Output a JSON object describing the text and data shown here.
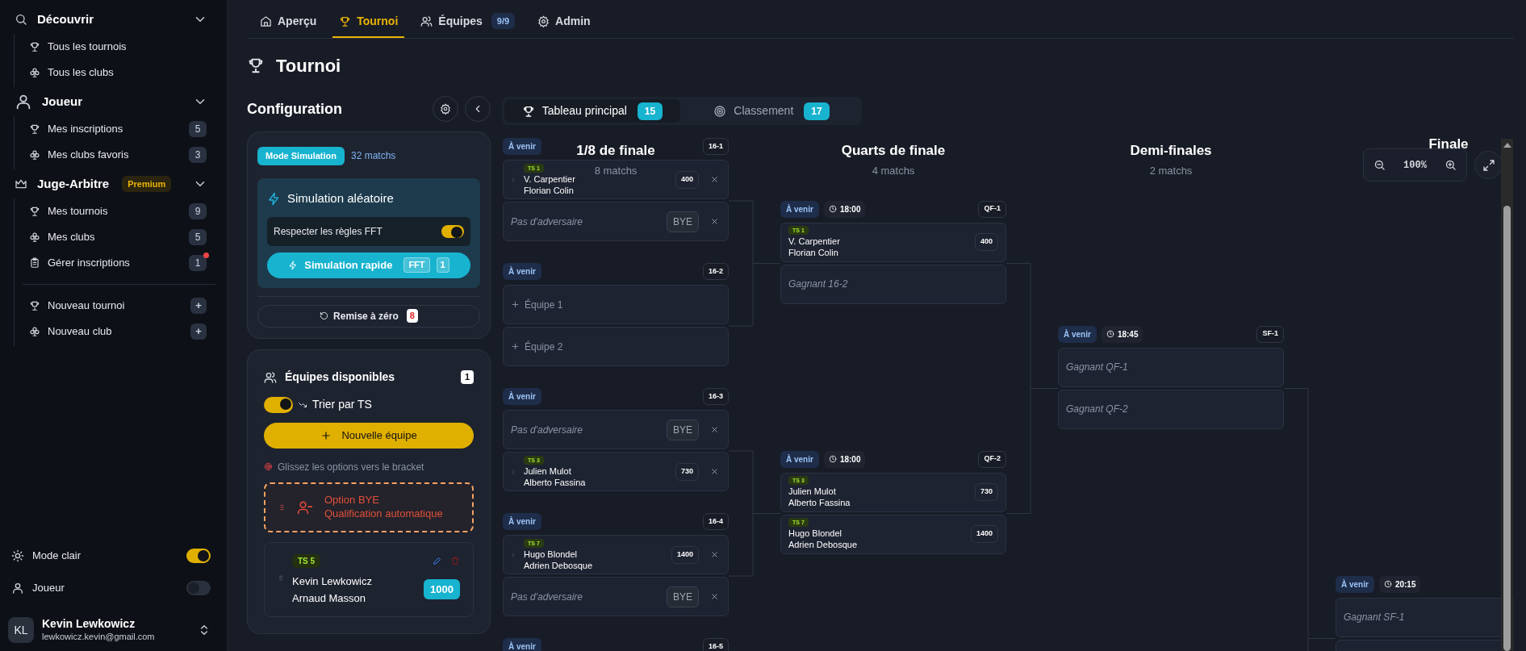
{
  "sidebar": {
    "sections": [
      {
        "title": "Découvrir",
        "expanded": true,
        "items": [
          {
            "label": "Tous les tournois",
            "notification": false
          },
          {
            "label": "Tous les clubs",
            "notification": false
          }
        ]
      },
      {
        "title": "Joueur",
        "expanded": true,
        "items": [
          {
            "label": "Mes inscriptions",
            "count": "5",
            "notification": false
          },
          {
            "label": "Mes clubs favoris",
            "count": "3",
            "notification": false
          }
        ]
      },
      {
        "title": "Juge-Arbitre",
        "badge": "Premium",
        "expanded": true,
        "items": [
          {
            "label": "Mes tournois",
            "count": "9",
            "notification": false
          },
          {
            "label": "Mes clubs",
            "count": "5",
            "notification": false
          },
          {
            "label": "Gérer inscriptions",
            "count": "1",
            "notification": true
          }
        ],
        "actions": [
          {
            "label": "Nouveau tournoi",
            "button": "+"
          },
          {
            "label": "Nouveau club",
            "button": "+"
          }
        ]
      }
    ],
    "settings": [
      {
        "label": "Mode clair",
        "on": true
      },
      {
        "label": "Joueur",
        "on": false
      }
    ],
    "user": {
      "initials": "KL",
      "name": "Kevin Lewkowicz",
      "email": "lewkowicz.kevin@gmail.com"
    }
  },
  "nav_tabs": [
    {
      "label": "Aperçu",
      "selected": false
    },
    {
      "label": "Tournoi",
      "selected": true
    },
    {
      "label": "Équipes",
      "badge": "9/9",
      "selected": false
    },
    {
      "label": "Admin",
      "selected": false
    }
  ],
  "page_title": "Tournoi",
  "config": {
    "title": "Configuration",
    "mode": "Mode Simulation",
    "match_count": "32 matchs",
    "simulation": {
      "title": "Simulation aléatoire",
      "rule_label": "Respecter les règles FFT",
      "rule_on": true,
      "button": "Simulation rapide",
      "button_tag": "FFT",
      "button_count": "1"
    },
    "reset": {
      "label": "Remise à zéro",
      "count": "8"
    }
  },
  "teams_panel": {
    "title": "Équipes disponibles",
    "count": "1",
    "sort_on": true,
    "sort_label": "Trier par TS",
    "new_button": "Nouvelle équipe",
    "hint": "Glissez les options vers le bracket",
    "bye_option": {
      "title": "Option BYE",
      "subtitle": "Qualification automatique"
    },
    "teams": [
      {
        "seed": "TS 5",
        "players": [
          "Kevin Lewkowicz",
          "Arnaud Masson"
        ],
        "points": "1000"
      }
    ]
  },
  "bracket": {
    "tabs": [
      {
        "label": "Tableau principal",
        "count": "15",
        "selected": true
      },
      {
        "label": "Classement",
        "count": "17",
        "selected": false
      }
    ],
    "zoom": "100%",
    "rounds": [
      {
        "title": "1/8 de finale",
        "subtitle": "8 matchs",
        "matches": [
          {
            "status": "À venir",
            "code": "16-1",
            "slots": [
              {
                "kind": "team",
                "seed": "TS 1",
                "players": [
                  "V. Carpentier",
                  "Florian Colin"
                ],
                "points": "400",
                "draggable": true,
                "removable": true
              },
              {
                "kind": "bye",
                "label": "Pas d'adversaire",
                "tag": "BYE",
                "removable": true
              }
            ]
          },
          {
            "status": "À venir",
            "code": "16-2",
            "slots": [
              {
                "kind": "add",
                "label": "Équipe 1"
              },
              {
                "kind": "add",
                "label": "Équipe 2"
              }
            ]
          },
          {
            "status": "À venir",
            "code": "16-3",
            "slots": [
              {
                "kind": "bye",
                "label": "Pas d'adversaire",
                "tag": "BYE",
                "removable": true
              },
              {
                "kind": "team",
                "seed": "TS 3",
                "players": [
                  "Julien Mulot",
                  "Alberto Fassina"
                ],
                "points": "730",
                "draggable": true,
                "removable": true
              }
            ]
          },
          {
            "status": "À venir",
            "code": "16-4",
            "slots": [
              {
                "kind": "team",
                "seed": "TS 7",
                "players": [
                  "Hugo Blondel",
                  "Adrien Debosque"
                ],
                "points": "1400",
                "draggable": true,
                "removable": true
              },
              {
                "kind": "bye",
                "label": "Pas d'adversaire",
                "tag": "BYE",
                "removable": true
              }
            ]
          },
          {
            "status": "À venir",
            "code": "16-5"
          }
        ]
      },
      {
        "title": "Quarts de finale",
        "subtitle": "4 matchs",
        "matches": [
          {
            "status": "À venir",
            "time": "18:00",
            "code": "QF-1",
            "slots": [
              {
                "kind": "team",
                "seed": "TS 1",
                "players": [
                  "V. Carpentier",
                  "Florian Colin"
                ],
                "points": "400",
                "draggable": false,
                "removable": false
              },
              {
                "kind": "placeholder",
                "label": "Gagnant 16-2"
              }
            ]
          },
          {
            "status": "À venir",
            "time": "18:00",
            "code": "QF-2",
            "slots": [
              {
                "kind": "team",
                "seed": "TS 3",
                "players": [
                  "Julien Mulot",
                  "Alberto Fassina"
                ],
                "points": "730",
                "draggable": false,
                "removable": false
              },
              {
                "kind": "team",
                "seed": "TS 7",
                "players": [
                  "Hugo Blondel",
                  "Adrien Debosque"
                ],
                "points": "1400",
                "draggable": false,
                "removable": false
              }
            ]
          }
        ]
      },
      {
        "title": "Demi-finales",
        "subtitle": "2 matchs",
        "matches": [
          {
            "status": "À venir",
            "time": "18:45",
            "code": "SF-1",
            "slots": [
              {
                "kind": "placeholder",
                "label": "Gagnant QF-1"
              },
              {
                "kind": "placeholder",
                "label": "Gagnant QF-2"
              }
            ]
          }
        ]
      },
      {
        "title": "Finale",
        "matches": [
          {
            "status": "À venir",
            "time": "20:15",
            "slots": [
              {
                "kind": "placeholder",
                "label": "Gagnant SF-1"
              },
              {
                "kind": "blank"
              }
            ]
          }
        ]
      }
    ]
  }
}
